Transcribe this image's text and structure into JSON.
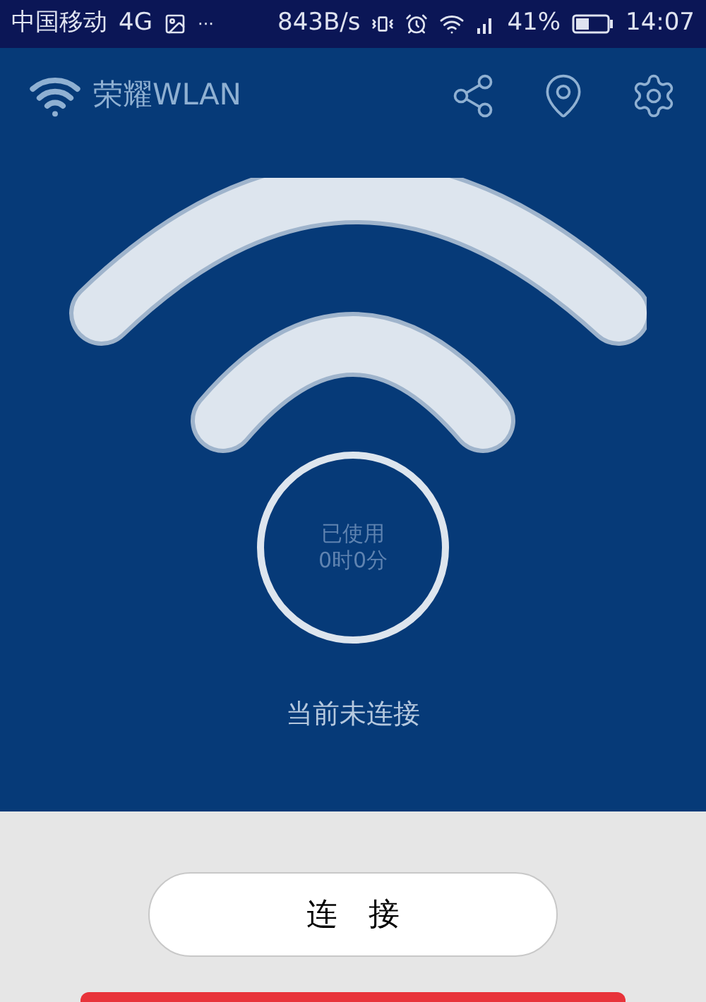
{
  "status_bar": {
    "carrier": "中国移动",
    "network": "4G",
    "more": "···",
    "speed": "843B/s",
    "battery": "41%",
    "time": "14:07"
  },
  "app_bar": {
    "title": "荣耀WLAN"
  },
  "usage": {
    "label": "已使用",
    "value": "0时0分"
  },
  "status_text": "当前未连接",
  "connect_button": {
    "label": "连　接"
  }
}
